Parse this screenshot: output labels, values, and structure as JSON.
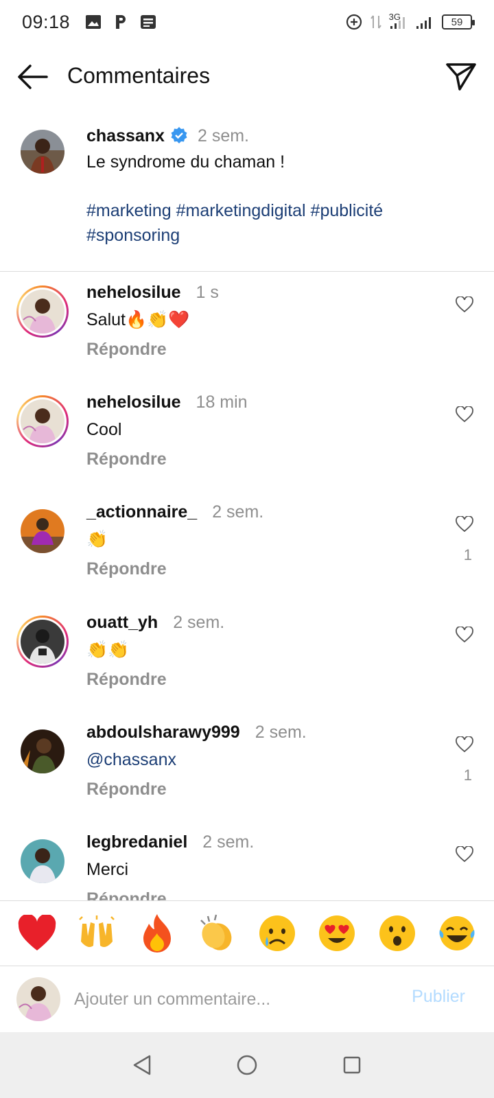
{
  "status_bar": {
    "time": "09:18",
    "network": "3G",
    "battery": "59"
  },
  "header": {
    "title": "Commentaires"
  },
  "caption": {
    "username": "chassanx",
    "time": "2 sem.",
    "text": "Le syndrome du chaman !",
    "hashtags_line1": "#marketing #marketingdigital #publicité",
    "hashtags_line2": "#sponsoring"
  },
  "comments": [
    {
      "username": "nehelosilue",
      "time": "1 s",
      "text": "Salut🔥👏❤️",
      "reply": "Répondre",
      "likes": ""
    },
    {
      "username": "nehelosilue",
      "time": "18 min",
      "text": "Cool",
      "reply": "Répondre",
      "likes": ""
    },
    {
      "username": "_actionnaire_",
      "time": "2 sem.",
      "text": "👏",
      "reply": "Répondre",
      "likes": "1"
    },
    {
      "username": "ouatt_yh",
      "time": "2 sem.",
      "text": "👏👏",
      "reply": "Répondre",
      "likes": ""
    },
    {
      "username": "abdoulsharawy999",
      "time": "2 sem.",
      "text": "@chassanx",
      "reply": "Répondre",
      "likes": "1"
    },
    {
      "username": "legbredaniel",
      "time": "2 sem.",
      "text": "Merci",
      "reply": "Répondre",
      "likes": ""
    }
  ],
  "emoji_bar": [
    "❤️",
    "🙌",
    "🔥",
    "👏",
    "😢",
    "😍",
    "😮",
    "😂"
  ],
  "composer": {
    "placeholder": "Ajouter un commentaire...",
    "publish_label": "Publier"
  },
  "colors": {
    "link": "#1c3e75",
    "muted": "#8e8e8e",
    "publish_disabled": "#b3dbff",
    "verified": "#3897f0"
  }
}
